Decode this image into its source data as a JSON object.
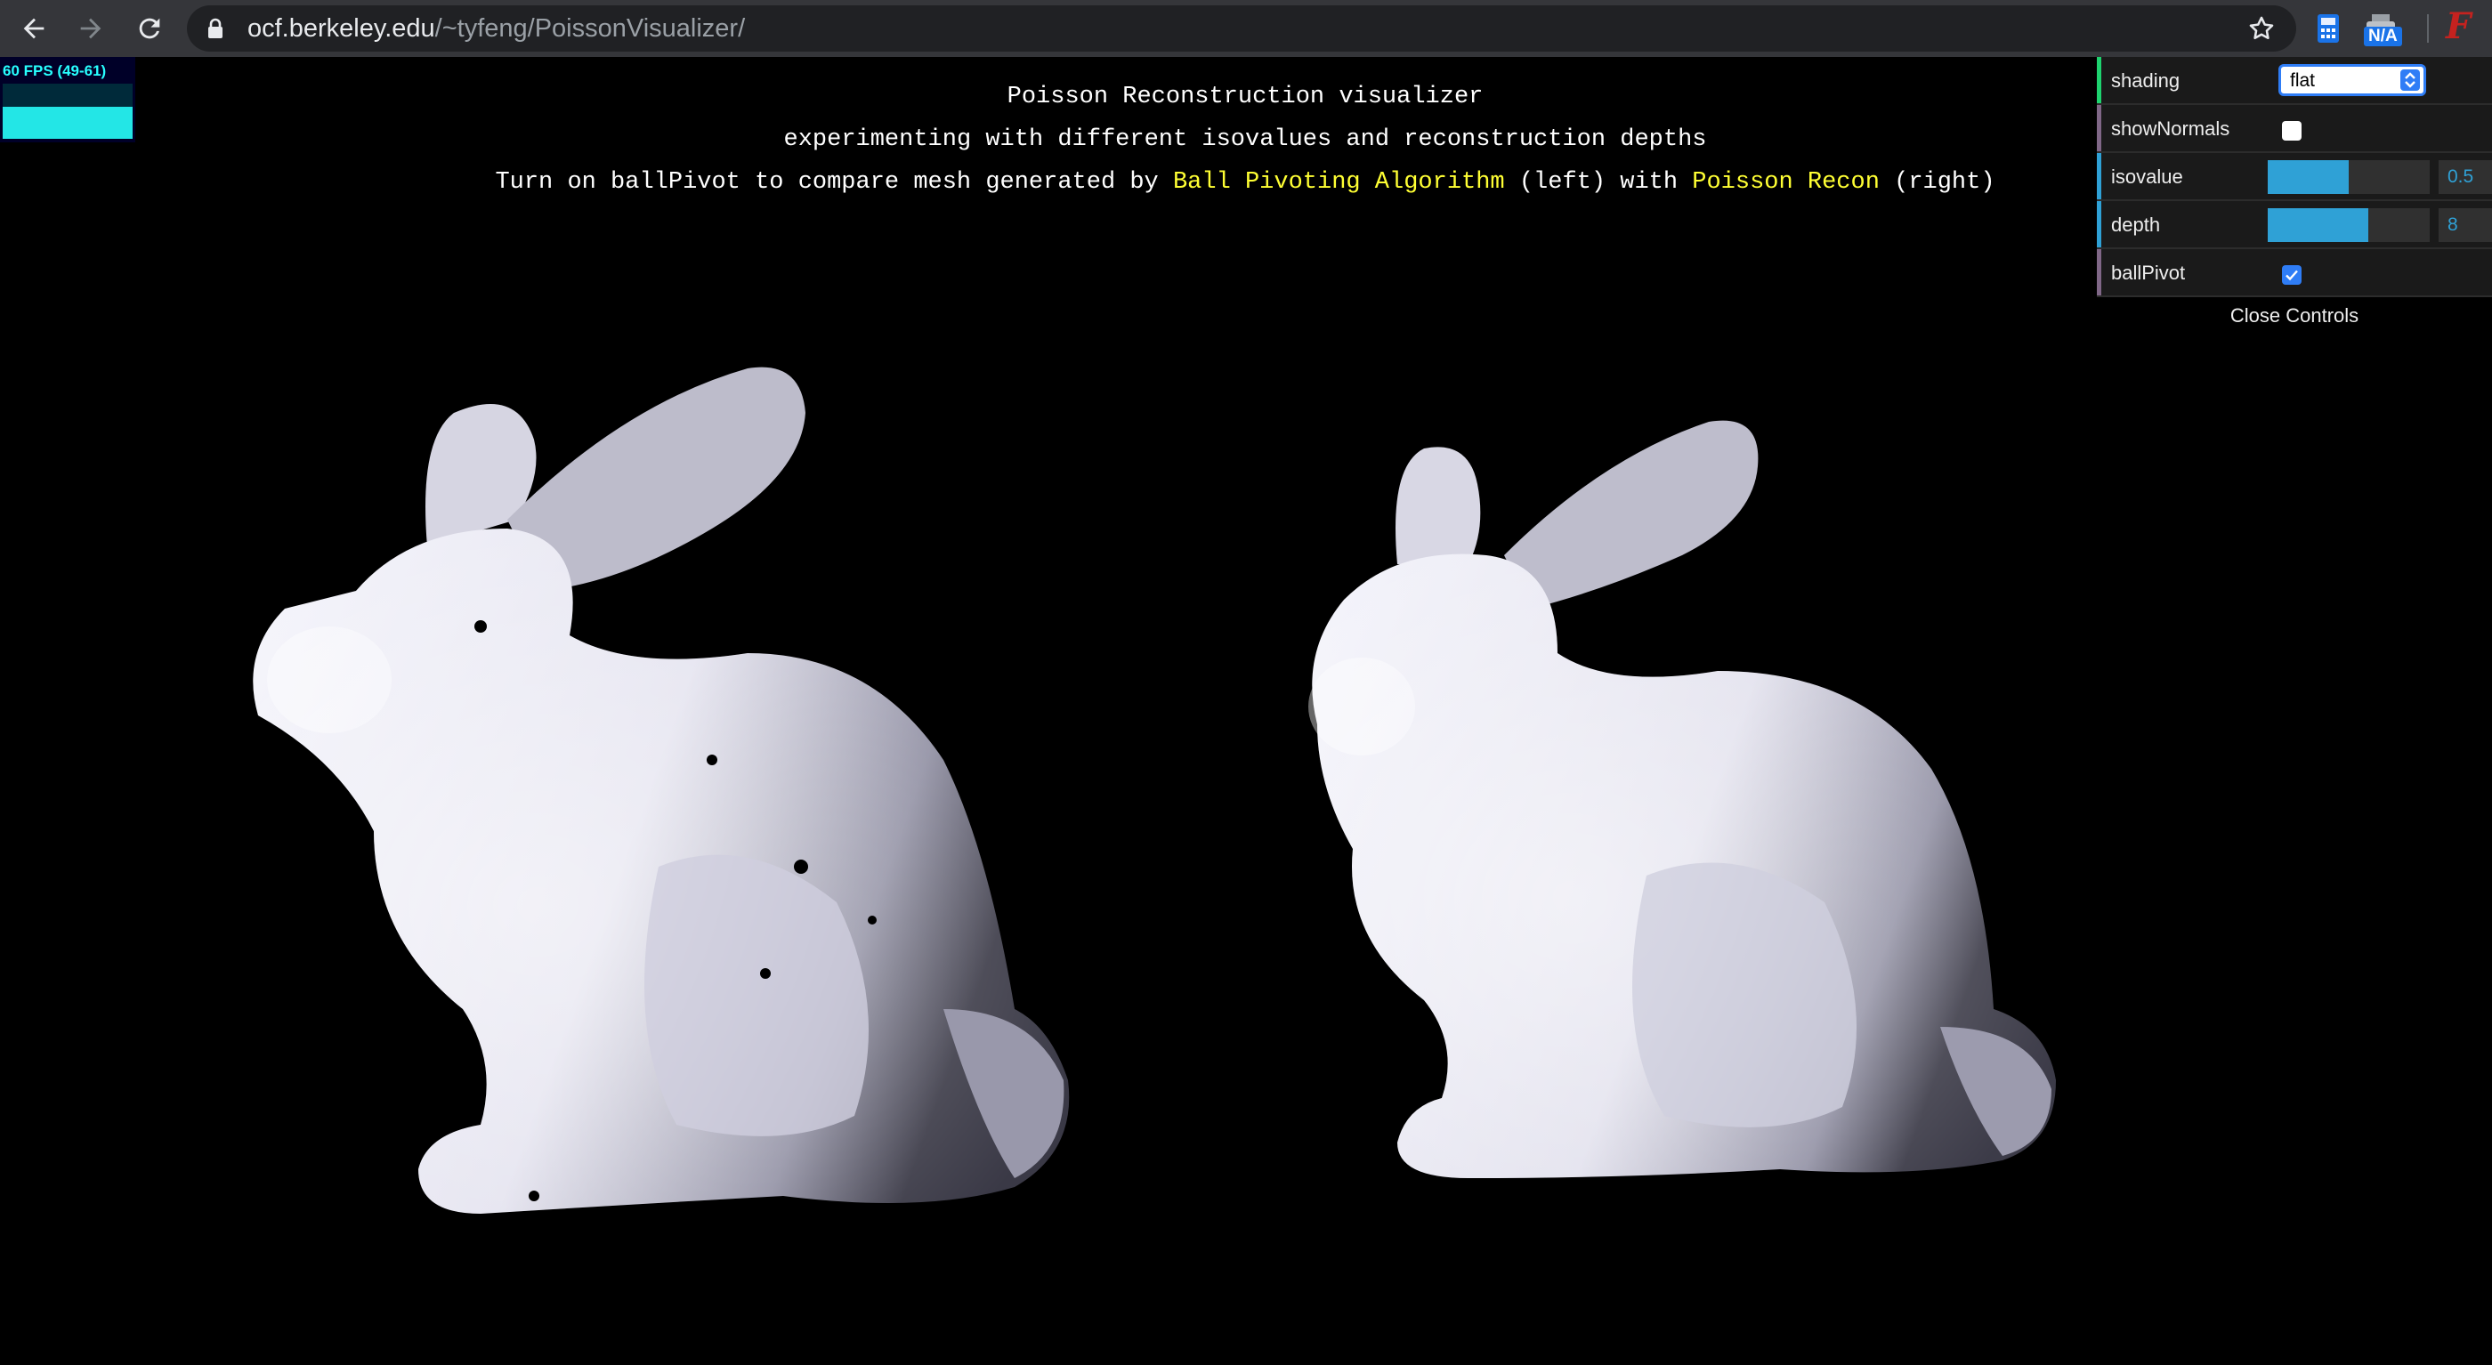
{
  "browser": {
    "url_domain": "ocf.berkeley.edu",
    "url_path": "/~tyfeng/PoissonVisualizer/",
    "back_icon": "arrow-left-icon",
    "forward_icon": "arrow-right-icon",
    "reload_icon": "reload-icon",
    "extension_badge": "N/A",
    "extension_letter": "F"
  },
  "stats": {
    "fps_text": "60 FPS (49-61)",
    "fps_value": 60
  },
  "header": {
    "title": "Poisson Reconstruction visualizer",
    "subtitle": "experimenting with different isovalues and reconstruction depths",
    "line3_prefix": "Turn on ballPivot to compare mesh generated by ",
    "line3_bpa": "Ball Pivoting Algorithm",
    "line3_mid": " (left) with ",
    "line3_poisson": "Poisson Recon",
    "line3_suffix": " (right)"
  },
  "controls": {
    "shading": {
      "label": "shading",
      "value": "flat"
    },
    "showNormals": {
      "label": "showNormals",
      "checked": false
    },
    "isovalue": {
      "label": "isovalue",
      "value": "0.5",
      "fill_fraction": 0.5
    },
    "depth": {
      "label": "depth",
      "value": "8",
      "fill_fraction": 0.62
    },
    "ballPivot": {
      "label": "ballPivot",
      "checked": true
    },
    "close_label": "Close Controls"
  },
  "colors": {
    "background": "#000000",
    "highlight": "#ffff33",
    "gui_accent": "#2fa1d6",
    "fps_text": "#27ffff"
  }
}
